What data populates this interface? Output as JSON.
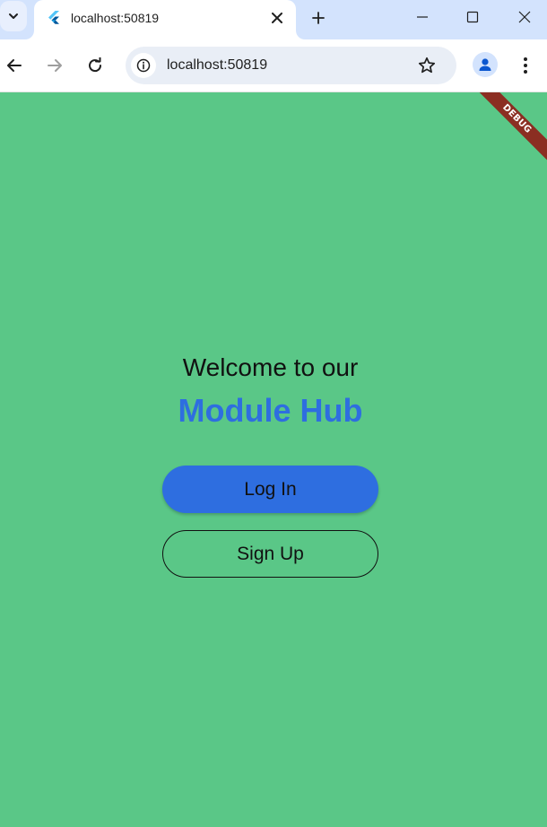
{
  "browser": {
    "tab": {
      "title": "localhost:50819",
      "favicon": "flutter-icon"
    },
    "address_bar": {
      "url": "localhost:50819"
    },
    "icons": {
      "tab_list": "chevron-down-icon",
      "close_tab": "close-icon",
      "new_tab": "plus-icon",
      "minimize": "minimize-icon",
      "maximize": "maximize-icon",
      "close_window": "close-icon",
      "back": "back-arrow-icon",
      "forward": "forward-arrow-icon",
      "reload": "reload-icon",
      "site_info": "info-icon",
      "bookmark": "star-icon",
      "profile": "profile-icon",
      "menu": "more-vert-icon"
    }
  },
  "app": {
    "debug_banner": "DEBUG",
    "welcome_text": "Welcome to our",
    "app_name": "Module Hub",
    "login_label": "Log In",
    "signup_label": "Sign Up",
    "colors": {
      "background": "#5ac787",
      "accent": "#2e6ee0",
      "debug_banner": "#8b2e22"
    }
  }
}
